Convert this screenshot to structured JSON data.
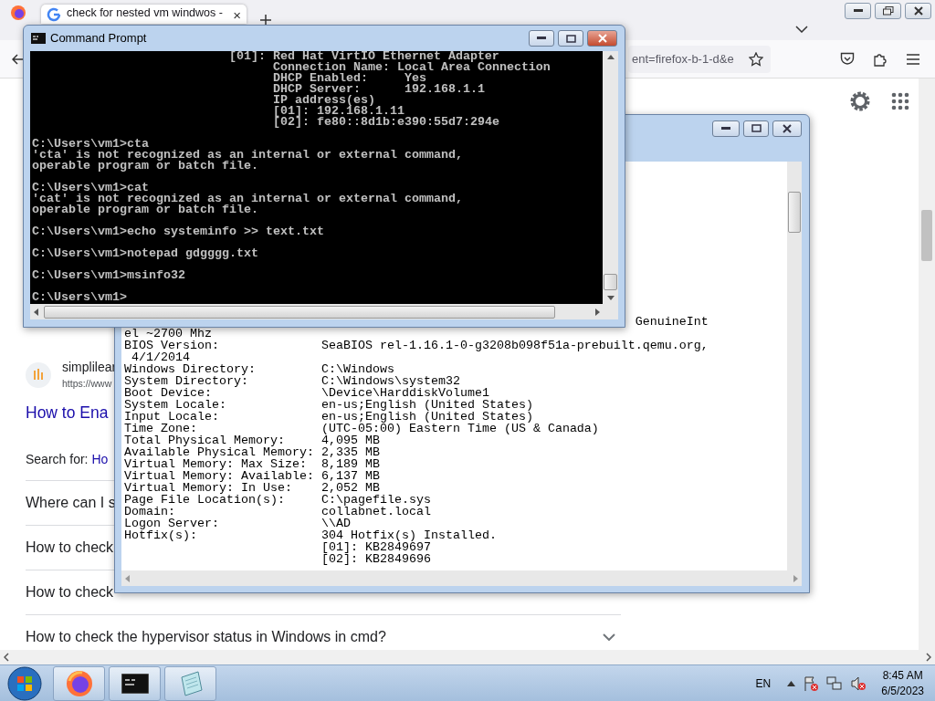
{
  "browser": {
    "tab": {
      "title": "check for nested vm windwos -",
      "close": "×"
    },
    "address": {
      "text": "ent=firefox-b-1-d&e"
    },
    "result": {
      "site": "simplilear",
      "url": "https://www",
      "title": "How to Ena"
    },
    "search_for": {
      "label": "Search for:",
      "query": "Ho"
    },
    "questions": [
      {
        "text": "Where can I s"
      },
      {
        "text": "How to check"
      },
      {
        "text": "How to check"
      },
      {
        "text": "How to check the hypervisor status in Windows in cmd?"
      }
    ]
  },
  "notepad": {
    "lines": [
      {
        "kind": "tail",
        "text": "GenuineInt"
      },
      {
        "kind": "text",
        "text": "el ~2700 Mhz"
      },
      {
        "kind": "pair",
        "label": "BIOS Version:",
        "value": "SeaBIOS rel-1.16.1-0-g3208b098f51a-prebuilt.qemu.org,"
      },
      {
        "kind": "indented",
        "text": "4/1/2014"
      },
      {
        "kind": "pair",
        "label": "Windows Directory:",
        "value": "C:\\Windows"
      },
      {
        "kind": "pair",
        "label": "System Directory:",
        "value": "C:\\Windows\\system32"
      },
      {
        "kind": "pair",
        "label": "Boot Device:",
        "value": "\\Device\\HarddiskVolume1"
      },
      {
        "kind": "pair",
        "label": "System Locale:",
        "value": "en-us;English (United States)"
      },
      {
        "kind": "pair",
        "label": "Input Locale:",
        "value": "en-us;English (United States)"
      },
      {
        "kind": "pair",
        "label": "Time Zone:",
        "value": "(UTC-05:00) Eastern Time (US & Canada)"
      },
      {
        "kind": "pair",
        "label": "Total Physical Memory:",
        "value": "4,095 MB"
      },
      {
        "kind": "pair",
        "label": "Available Physical Memory:",
        "value": "2,335 MB"
      },
      {
        "kind": "pair",
        "label": "Virtual Memory: Max Size:",
        "value": "8,189 MB"
      },
      {
        "kind": "pair",
        "label": "Virtual Memory: Available:",
        "value": "6,137 MB"
      },
      {
        "kind": "pair",
        "label": "Virtual Memory: In Use:",
        "value": "2,052 MB"
      },
      {
        "kind": "pair",
        "label": "Page File Location(s):",
        "value": "C:\\pagefile.sys"
      },
      {
        "kind": "pair",
        "label": "Domain:",
        "value": "collabnet.local"
      },
      {
        "kind": "pair",
        "label": "Logon Server:",
        "value": "\\\\AD"
      },
      {
        "kind": "pair",
        "label": "Hotfix(s):",
        "value": "304 Hotfix(s) Installed."
      },
      {
        "kind": "value",
        "text": "[01]: KB2849697"
      },
      {
        "kind": "value",
        "text": "[02]: KB2849696"
      }
    ]
  },
  "cmd": {
    "title": "Command Prompt",
    "lines": [
      {
        "kind": "adapter",
        "text": "[01]: Red Hat VirtIO Ethernet Adapter"
      },
      {
        "kind": "detail",
        "text": "Connection Name: Local Area Connection"
      },
      {
        "kind": "detail",
        "text": "DHCP Enabled:     Yes"
      },
      {
        "kind": "detail",
        "text": "DHCP Server:      192.168.1.1"
      },
      {
        "kind": "detail",
        "text": "IP address(es)"
      },
      {
        "kind": "detail",
        "text": "[01]: 192.168.1.11"
      },
      {
        "kind": "detail",
        "text": "[02]: fe80::8d1b:e390:55d7:294e"
      },
      {
        "kind": "blank"
      },
      {
        "kind": "line",
        "text": "C:\\Users\\vm1>cta"
      },
      {
        "kind": "line",
        "text": "'cta' is not recognized as an internal or external command,"
      },
      {
        "kind": "line",
        "text": "operable program or batch file."
      },
      {
        "kind": "blank"
      },
      {
        "kind": "line",
        "text": "C:\\Users\\vm1>cat"
      },
      {
        "kind": "line",
        "text": "'cat' is not recognized as an internal or external command,"
      },
      {
        "kind": "line",
        "text": "operable program or batch file."
      },
      {
        "kind": "blank"
      },
      {
        "kind": "line",
        "text": "C:\\Users\\vm1>echo systeminfo >> text.txt"
      },
      {
        "kind": "blank"
      },
      {
        "kind": "line",
        "text": "C:\\Users\\vm1>notepad gdgggg.txt"
      },
      {
        "kind": "blank"
      },
      {
        "kind": "line",
        "text": "C:\\Users\\vm1>msinfo32"
      },
      {
        "kind": "blank"
      },
      {
        "kind": "line",
        "text": "C:\\Users\\vm1>"
      }
    ]
  },
  "taskbar": {
    "language": "EN",
    "time": "8:45 AM",
    "date": "6/5/2023"
  }
}
